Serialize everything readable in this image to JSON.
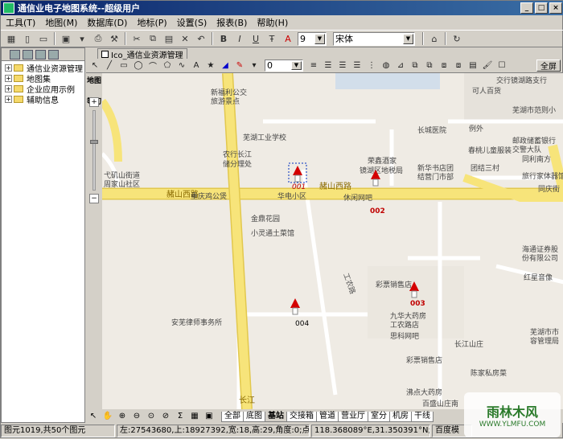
{
  "window": {
    "title": "通信业电子地图系统--超级用户"
  },
  "menus": [
    "工具(T)",
    "地图(M)",
    "数据库(D)",
    "地标(P)",
    "设置(S)",
    "报表(B)",
    "帮助(H)"
  ],
  "format_toolbar": {
    "font_size": "9",
    "font_name": "宋体"
  },
  "tree": {
    "items": [
      "通信业资源管理",
      "地图集",
      "企业应用示例",
      "辅助信息"
    ]
  },
  "doc_tab": {
    "label": "Ico_通信业资源管理"
  },
  "draw_toolbar": {
    "line_width": "0",
    "fullscreen_label": "全屏"
  },
  "map": {
    "strip_labels": {
      "top": "地图",
      "middle": "等切"
    },
    "roads": {
      "heshan": "赭山西路",
      "heshan2": "赭山西路",
      "gongnong": "工农路",
      "changjiang": "长江"
    },
    "pois": [
      "新福利公交",
      "旅游景点",
      "芜湖工业学校",
      "农行长江",
      "储分理处",
      "重庆鸡公煲",
      "华电小区",
      "金鼎花园",
      "小灵通土菜馆",
      "荣鑫酒家",
      "镜湖区地税局",
      "新华书店团",
      "结营门市部",
      "团结三村",
      "长城医院",
      "例外",
      "春桃儿童服装",
      "可人百货",
      "交行镜湖路支行",
      "芜湖市范则小",
      "邮政储蓄银行",
      "交警大队",
      "同利南方",
      "旅行家体器馆",
      "同庆街",
      "休闲网吧",
      "彩票销售店",
      "九华大药房",
      "工农路店",
      "思科网吧",
      "彩票销售店",
      "长江山庄",
      "陈家私房菜",
      "沸点大药房",
      "百盛山庄南",
      "红星音像",
      "海通证券股",
      "份有限公司",
      "芜湖市市",
      "容管理局",
      "安芜律师事务所",
      "弋矶山街道",
      "周家山社区"
    ],
    "markers": [
      "001",
      "002",
      "003",
      "004"
    ]
  },
  "bottom_toolbar": {
    "layer_tabs": [
      "全部",
      "底图",
      "基站",
      "交接箱",
      "管道",
      "营业厅",
      "室分",
      "机房",
      "干线"
    ]
  },
  "status": {
    "objects": "图元1019,共50个图元",
    "coords": "左:27543680,上:18927392,宽:18,高:29,角度:0;点:未选中",
    "lonlat": "118.368089°E,31.350391°N;16级",
    "source": "百度模",
    "watermark_top": "雨林木风",
    "watermark_bottom": "WWW.YLMFU.COM"
  },
  "colors": {
    "title_start": "#0a246a",
    "title_end": "#3a6ea5",
    "road_major": "#f7e47a",
    "marker_red": "#d40000",
    "marker_label": "#c00000"
  }
}
